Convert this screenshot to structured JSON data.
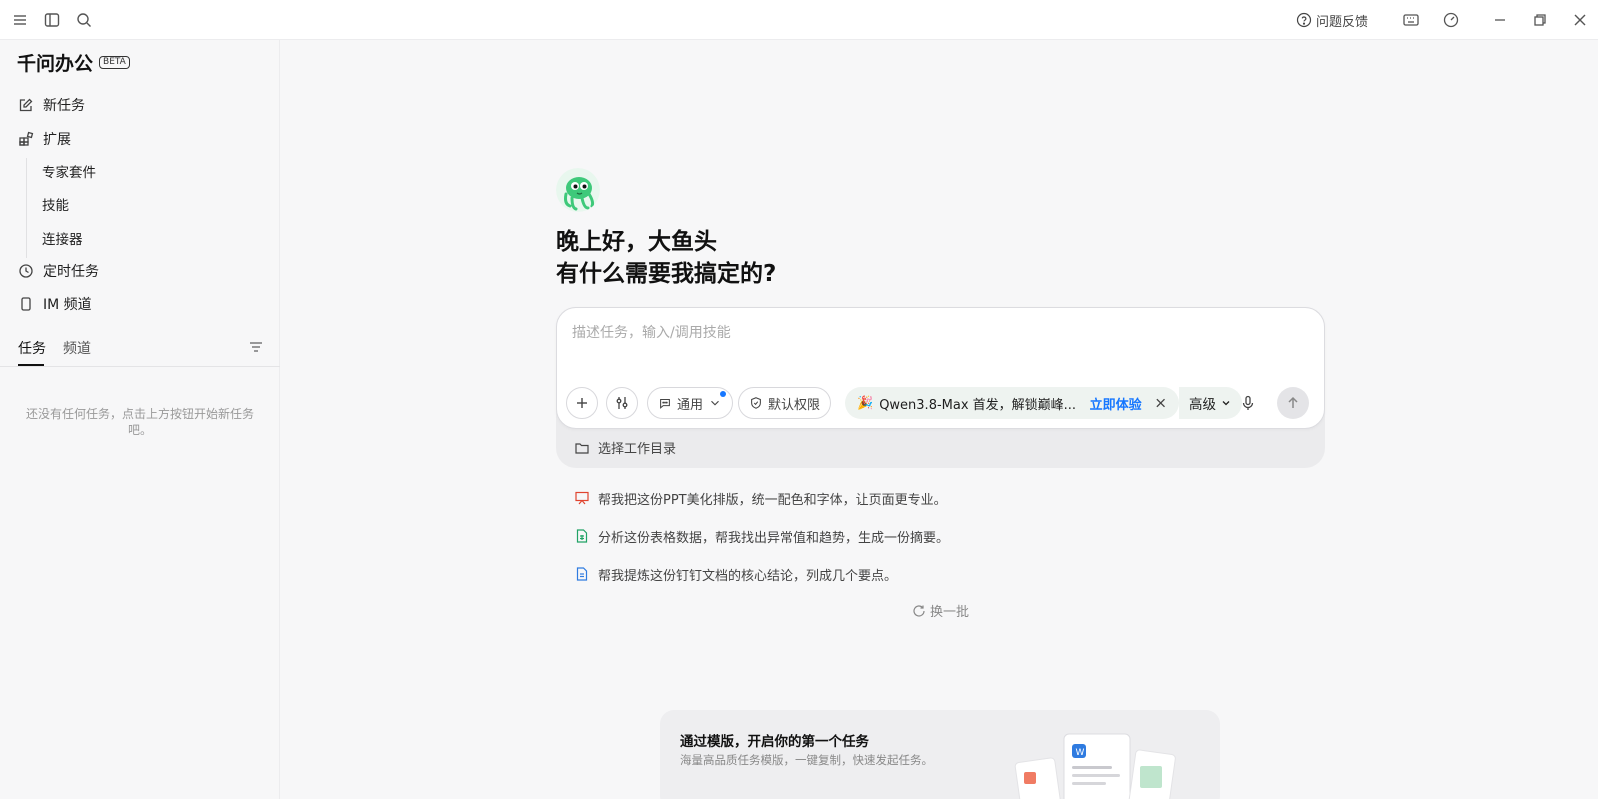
{
  "window": {
    "feedback_label": "问题反馈"
  },
  "sidebar": {
    "brand": "千问办公",
    "beta_badge": "BETA",
    "nav": [
      {
        "label": "新任务",
        "icon": "edit-icon"
      },
      {
        "label": "扩展",
        "icon": "extension-icon"
      }
    ],
    "sub_items": [
      "专家套件",
      "技能",
      "连接器"
    ],
    "nav_bottom": [
      {
        "label": "定时任务",
        "icon": "clock-icon"
      },
      {
        "label": "IM 频道",
        "icon": "phone-icon"
      }
    ],
    "tabs": [
      "任务",
      "频道"
    ],
    "empty_text": "还没有任何任务，点击上方按钮开始新任务吧。"
  },
  "main": {
    "greeting_line1": "晚上好，大鱼头",
    "greeting_line2": "有什么需要我搞定的?",
    "input_placeholder": "描述任务，输入/调用技能",
    "mode_label": "通用",
    "permission_label": "默认权限",
    "promo_emoji": "🎉",
    "promo_text": "Qwen3.8-Max 首发，解锁巅峰...",
    "promo_cta": "立即体验",
    "advanced_label": "高级",
    "workdir_label": "选择工作目录",
    "suggestions": [
      {
        "text": "帮我把这份PPT美化排版，统一配色和字体，让页面更专业。",
        "icon": "presentation-icon",
        "color": "#e0442f"
      },
      {
        "text": "分析这份表格数据，帮我找出异常值和趋势，生成一份摘要。",
        "icon": "spreadsheet-icon",
        "color": "#21a366"
      },
      {
        "text": "帮我提炼这份钉钉文档的核心结论，列成几个要点。",
        "icon": "document-icon",
        "color": "#2f7be0"
      }
    ],
    "refresh_label": "换一批",
    "template_card": {
      "title": "通过模版，开启你的第一个任务",
      "subtitle": "海量高品质任务模版，一键复制，快速发起任务。"
    }
  },
  "colors": {
    "accent": "#1677ff",
    "mascot": "#3ec97a"
  }
}
